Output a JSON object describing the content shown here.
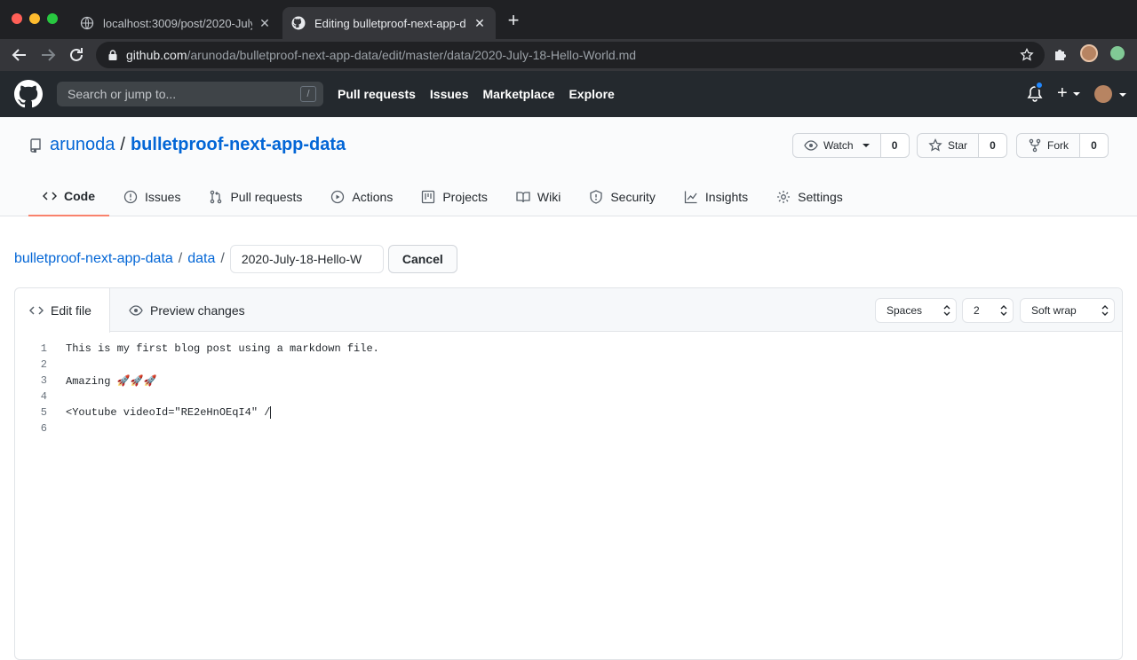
{
  "browser": {
    "tabs": [
      {
        "title": "localhost:3009/post/2020-July",
        "active": false
      },
      {
        "title": "Editing bulletproof-next-app-d",
        "active": true
      }
    ],
    "url_host": "github.com",
    "url_path": "/arunoda/bulletproof-next-app-data/edit/master/data/2020-July-18-Hello-World.md"
  },
  "gh_header": {
    "search_placeholder": "Search or jump to...",
    "search_shortcut": "/",
    "nav": [
      "Pull requests",
      "Issues",
      "Marketplace",
      "Explore"
    ],
    "plus": "+"
  },
  "repo": {
    "owner": "arunoda",
    "separator": "/",
    "name": "bulletproof-next-app-data",
    "watch": {
      "label": "Watch",
      "count": "0"
    },
    "star": {
      "label": "Star",
      "count": "0"
    },
    "fork": {
      "label": "Fork",
      "count": "0"
    },
    "tabs": [
      "Code",
      "Issues",
      "Pull requests",
      "Actions",
      "Projects",
      "Wiki",
      "Security",
      "Insights",
      "Settings"
    ],
    "active_tab": "Code"
  },
  "editor": {
    "breadcrumb_repo": "bulletproof-next-app-data",
    "breadcrumb_dir": "data",
    "slash": "/",
    "filename": "2020-July-18-Hello-W",
    "cancel": "Cancel",
    "edit_tab": "Edit file",
    "preview_tab": "Preview changes",
    "indent_mode": "Spaces",
    "indent_size": "2",
    "wrap_mode": "Soft wrap",
    "lines": [
      {
        "n": "1",
        "text": "This is my first blog post using a markdown file."
      },
      {
        "n": "2",
        "text": ""
      },
      {
        "n": "3",
        "text": "Amazing 🚀🚀🚀"
      },
      {
        "n": "4",
        "text": ""
      },
      {
        "n": "5",
        "text": "<Youtube videoId=\"RE2eHnOEqI4\" /"
      },
      {
        "n": "6",
        "text": ""
      }
    ]
  },
  "colors": {
    "link": "#0366d6",
    "header_bg": "#24292e",
    "active_tab_underline": "#f9826c"
  }
}
